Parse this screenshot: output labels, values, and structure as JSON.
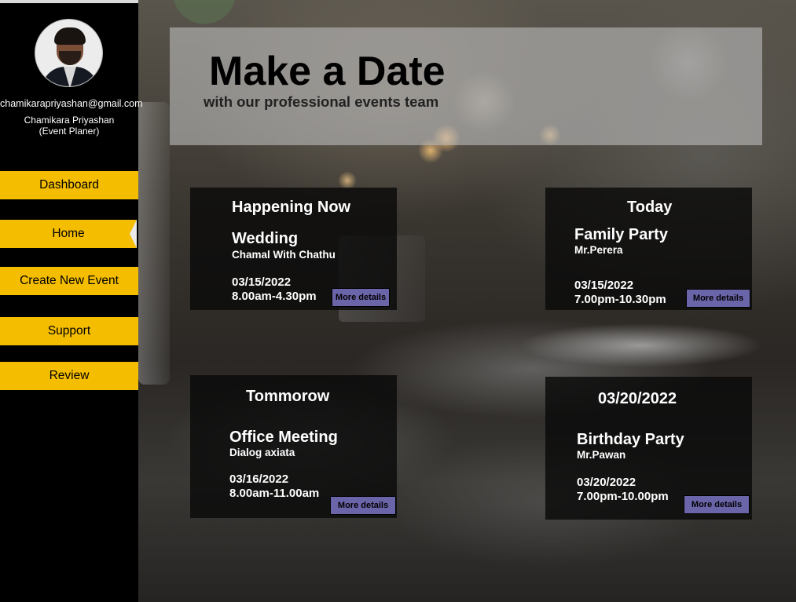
{
  "sidebar": {
    "email": "chamikarapriyashan@gmail.com",
    "user_name": "Chamikara Priyashan",
    "user_role": "(Event Planer)",
    "nav": {
      "dashboard": "Dashboard",
      "home": "Home",
      "create": "Create New Event",
      "support": "Support",
      "review": "Review"
    },
    "active_item": "Home",
    "accent_color": "#f4bd00"
  },
  "banner": {
    "title": "Make a Date",
    "subtitle": "with our professional events team"
  },
  "cards": [
    {
      "heading": "Happening Now",
      "event": "Wedding",
      "host": "Chamal With Chathu",
      "date": "03/15/2022",
      "time": "8.00am-4.30pm",
      "button": "More details"
    },
    {
      "heading": "Today",
      "event": "Family Party",
      "host": "Mr.Perera",
      "date": "03/15/2022",
      "time": "7.00pm-10.30pm",
      "button": "More details"
    },
    {
      "heading": "Tommorow",
      "event": "Office Meeting",
      "host": "Dialog axiata",
      "date": "03/16/2022",
      "time": "8.00am-11.00am",
      "button": "More details"
    },
    {
      "heading": "03/20/2022",
      "event": "Birthday Party",
      "host": "Mr.Pawan",
      "date": "03/20/2022",
      "time": "7.00pm-10.00pm",
      "button": "More details"
    }
  ],
  "button_color": "#6a64a8"
}
